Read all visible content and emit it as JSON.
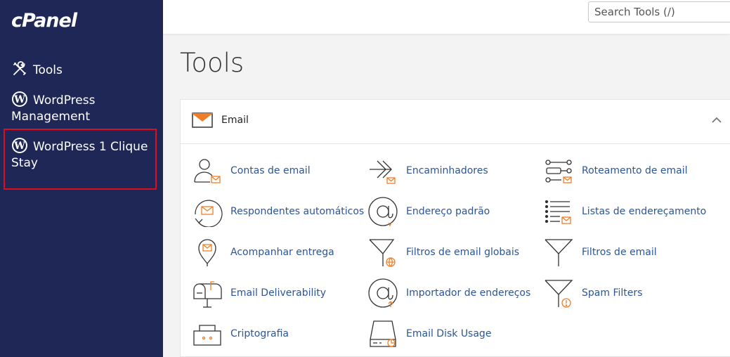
{
  "sidebar": {
    "logo": "cPanel",
    "items": [
      {
        "label": "Tools",
        "icon": "tools-icon"
      },
      {
        "label": "WordPress Management",
        "icon": "wordpress-icon"
      },
      {
        "label": "WordPress 1 Clique Stay",
        "icon": "wordpress-icon",
        "highlighted": true
      }
    ]
  },
  "header": {
    "search_placeholder": "Search Tools (/)"
  },
  "page": {
    "title": "Tools"
  },
  "email_section": {
    "title": "Email",
    "expanded": true,
    "items": [
      {
        "label": "Contas de email",
        "icon": "email-accounts-icon"
      },
      {
        "label": "Encaminhadores",
        "icon": "forwarders-icon"
      },
      {
        "label": "Roteamento de email",
        "icon": "email-routing-icon"
      },
      {
        "label": "Respondentes automáticos",
        "icon": "autoresponders-icon"
      },
      {
        "label": "Endereço padrão",
        "icon": "default-address-icon"
      },
      {
        "label": "Listas de endereçamento",
        "icon": "mailing-lists-icon"
      },
      {
        "label": "Acompanhar entrega",
        "icon": "track-delivery-icon"
      },
      {
        "label": "Filtros de email globais",
        "icon": "global-filters-icon"
      },
      {
        "label": "Filtros de email",
        "icon": "email-filters-icon"
      },
      {
        "label": "Email Deliverability",
        "icon": "email-deliverability-icon"
      },
      {
        "label": "Importador de endereços",
        "icon": "address-importer-icon"
      },
      {
        "label": "Spam Filters",
        "icon": "spam-filters-icon"
      },
      {
        "label": "Criptografia",
        "icon": "encryption-icon"
      },
      {
        "label": "Email Disk Usage",
        "icon": "disk-usage-icon"
      }
    ]
  },
  "colors": {
    "sidebar_bg": "#1f2757",
    "accent_orange": "#f07e26",
    "link_blue": "#2c5597",
    "highlight_red": "#e00b1c"
  }
}
